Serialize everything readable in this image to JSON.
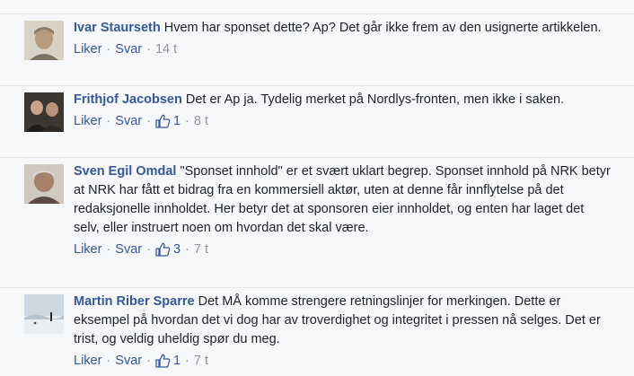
{
  "comments": [
    {
      "author": "Ivar Staurseth",
      "text": "Hvem har sponset dette? Ap? Det går ikke frem av den usignerte artikkelen.",
      "like_label": "Liker",
      "reply_label": "Svar",
      "like_count": "",
      "time": "14 t",
      "avatar_icon": "person-portrait"
    },
    {
      "author": "Frithjof Jacobsen",
      "text": "Det er Ap ja. Tydelig merket på Nordlys-fronten, men ikke i saken.",
      "like_label": "Liker",
      "reply_label": "Svar",
      "like_count": "1",
      "time": "8 t",
      "avatar_icon": "two-people-portrait"
    },
    {
      "author": "Sven Egil Omdal",
      "text": "\"Sponset innhold\" er et svært uklart begrep. Sponset innhold på NRK betyr at NRK har fått et bidrag fra en kommersiell aktør, uten at denne får innflytelse på det redaksjonelle innholdet. Her betyr det at sponsoren eier innholdet, og enten har laget det selv, eller instruert noen om hvordan det skal være.",
      "like_label": "Liker",
      "reply_label": "Svar",
      "like_count": "3",
      "time": "7 t",
      "avatar_icon": "person-portrait"
    },
    {
      "author": "Martin Riber Sparre",
      "text": "Det MÅ komme strengere retningslinjer for merkingen. Dette er eksempel på hvordan det vi dog har av troverdighet og integritet i pressen nå selges. Det er trist, og veldig uheldig spør du meg.",
      "like_label": "Liker",
      "reply_label": "Svar",
      "like_count": "1",
      "time": "7 t",
      "avatar_icon": "landscape-photo"
    }
  ],
  "colors": {
    "background": "#f6f7f9",
    "author": "#365899",
    "text": "#1d2129",
    "meta": "#90949c"
  }
}
